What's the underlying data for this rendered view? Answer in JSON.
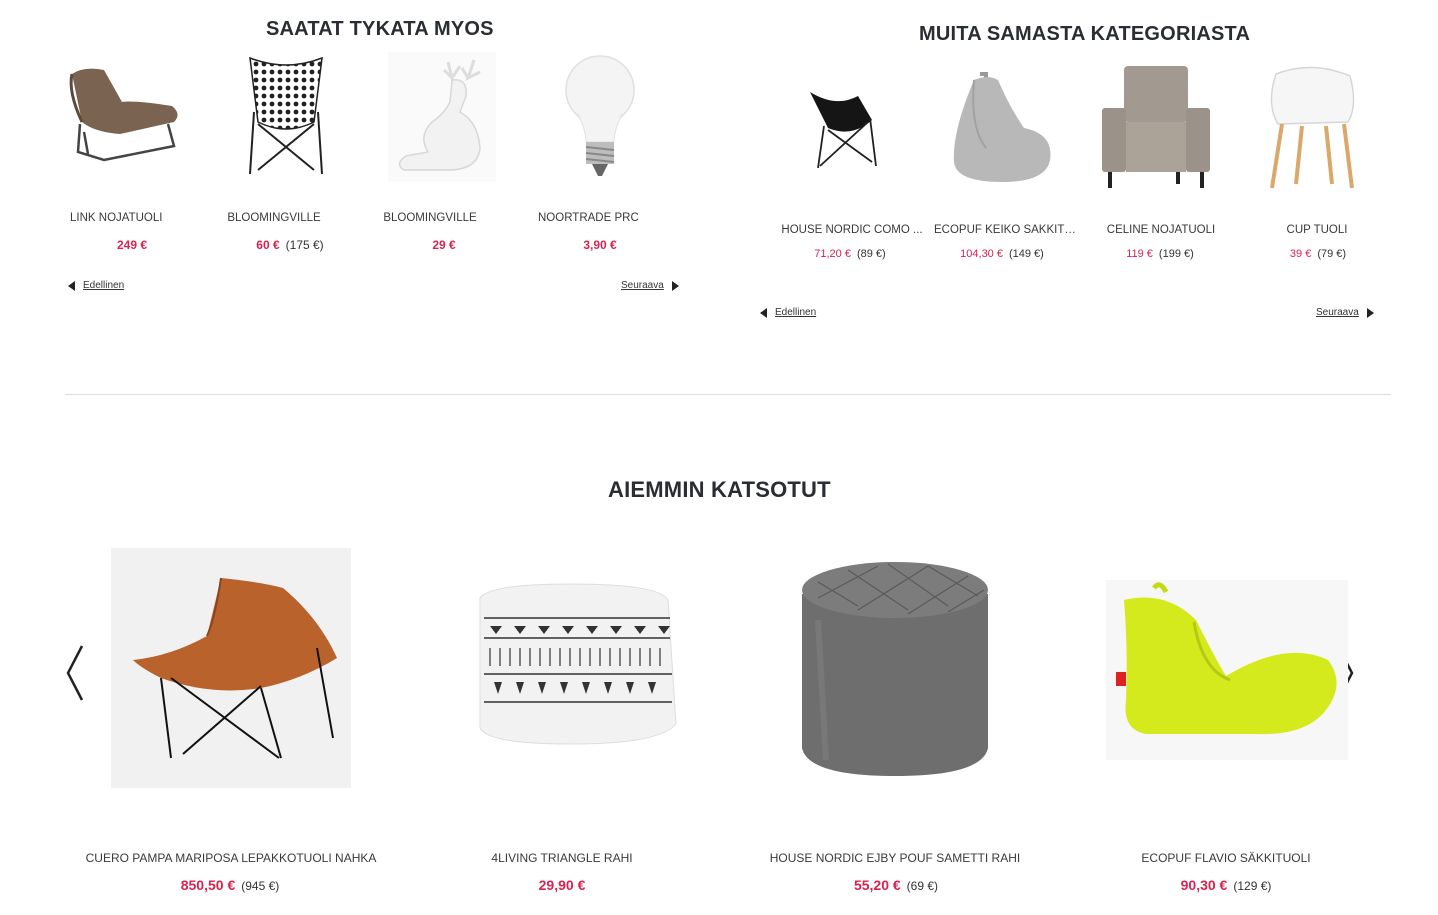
{
  "may_like": {
    "title": "SAATAT TYKATA MYOS",
    "items": [
      {
        "name": "LINK NOJATUOLI",
        "price": "249 €",
        "orig": "",
        "icon": "lounge-chair-icon"
      },
      {
        "name": "BLOOMINGVILLE",
        "price": "60 €",
        "orig": "(175 €)",
        "icon": "butterfly-chair-icon"
      },
      {
        "name": "BLOOMINGVILLE",
        "price": "29 €",
        "orig": "",
        "icon": "deer-figurine-icon"
      },
      {
        "name": "NOORTRADE PRC",
        "price": "3,90 €",
        "orig": "",
        "icon": "light-bulb-icon"
      }
    ],
    "prev": "Edellinen",
    "next": "Seuraava"
  },
  "same_category": {
    "title": "MUITA SAMASTA KATEGORIASTA",
    "items": [
      {
        "name": "HOUSE NORDIC COMO ...",
        "price": "71,20 €",
        "orig": "(89 €)",
        "icon": "butterfly-chair-icon"
      },
      {
        "name": "ECOPUF KEIKO SÄKKITU...",
        "price": "104,30 €",
        "orig": "(149 €)",
        "icon": "bean-bag-icon"
      },
      {
        "name": "CELINE NOJATUOLI",
        "price": "119 €",
        "orig": "(199 €)",
        "icon": "armchair-icon"
      },
      {
        "name": "CUP TUOLI",
        "price": "39 €",
        "orig": "(79 €)",
        "icon": "chair-icon"
      }
    ],
    "prev": "Edellinen",
    "next": "Seuraava"
  },
  "recently_viewed": {
    "title": "AIEMMIN KATSOTUT",
    "items": [
      {
        "name": "CUERO PAMPA MARIPOSA LEPAKKOTUOLI NAHKA",
        "price": "850,50 €",
        "orig": "(945 €)",
        "icon": "leather-butterfly-chair-icon"
      },
      {
        "name": "4LIVING TRIANGLE RAHI",
        "price": "29,90 €",
        "orig": "",
        "icon": "pouf-icon"
      },
      {
        "name": "HOUSE NORDIC EJBY POUF SAMETTI RAHI",
        "price": "55,20 €",
        "orig": "(69 €)",
        "icon": "velvet-pouf-icon"
      },
      {
        "name": "ECOPUF FLAVIO SÄKKITUOLI",
        "price": "90,30 €",
        "orig": "(129 €)",
        "icon": "yellow-bean-bag-icon"
      }
    ]
  },
  "colors": {
    "sale": "#d6234f",
    "title": "#2a2e33",
    "divider": "#dddddd",
    "bean_yellow": "#d5ea1c"
  }
}
